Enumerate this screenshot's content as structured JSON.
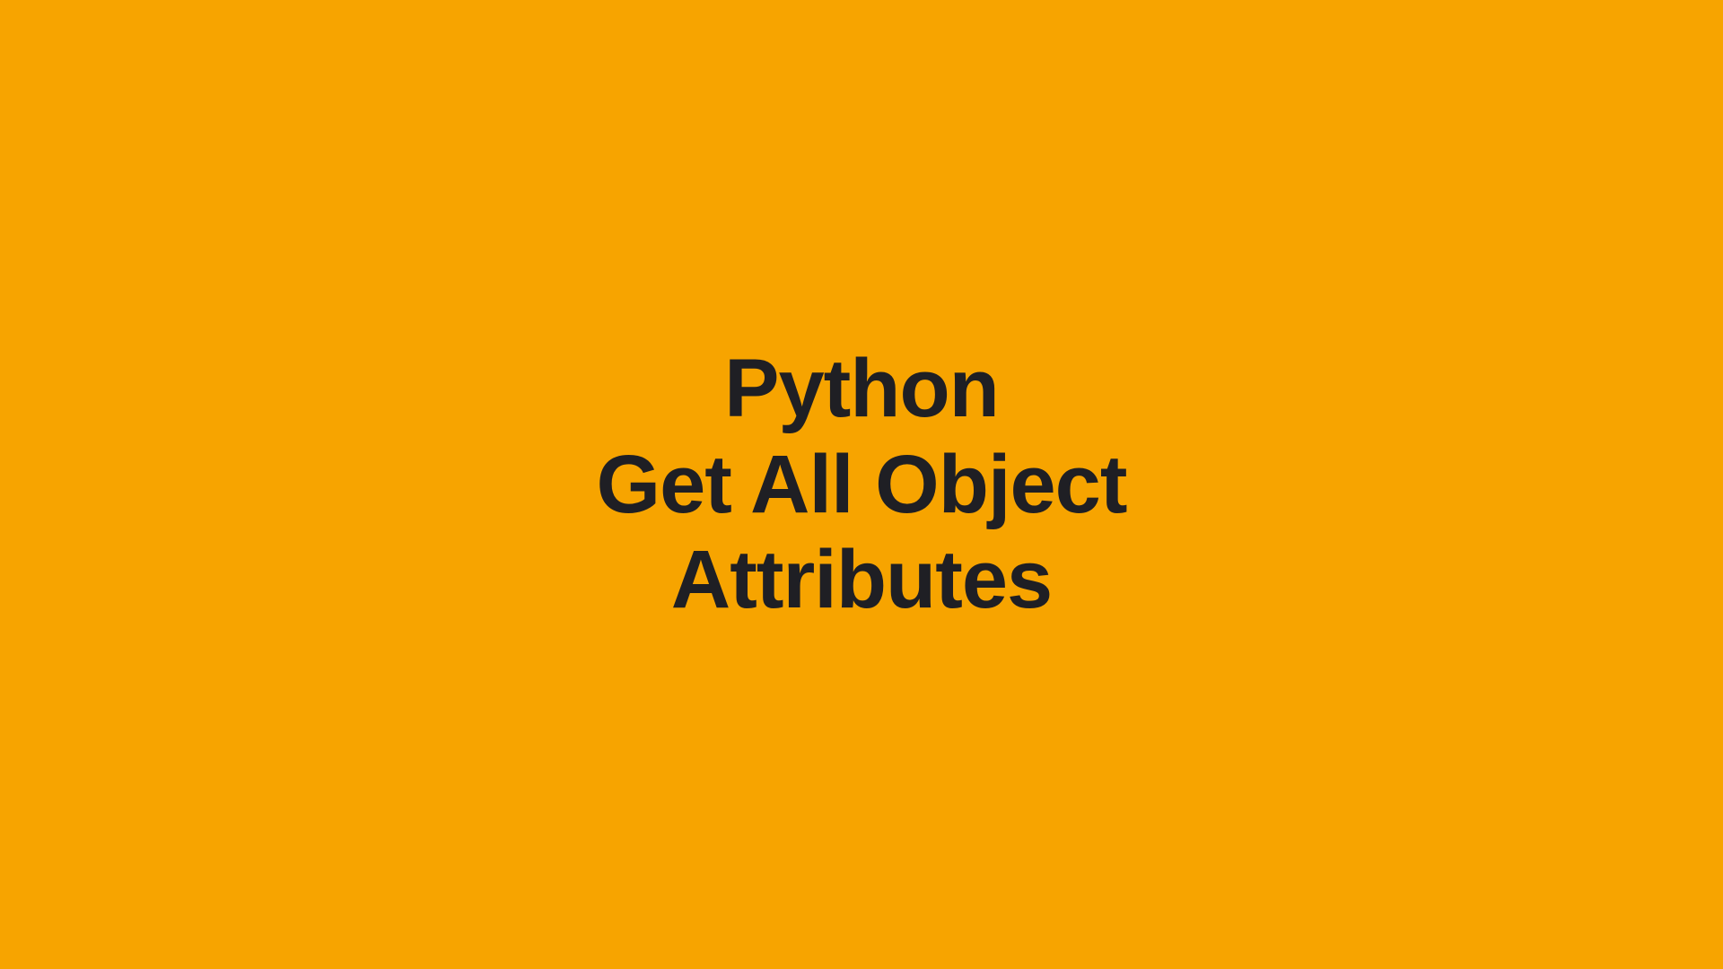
{
  "title": {
    "line1": "Python",
    "line2": "Get All Object",
    "line3": "Attributes"
  },
  "colors": {
    "background": "#f7a400",
    "text": "#1f1f24"
  }
}
